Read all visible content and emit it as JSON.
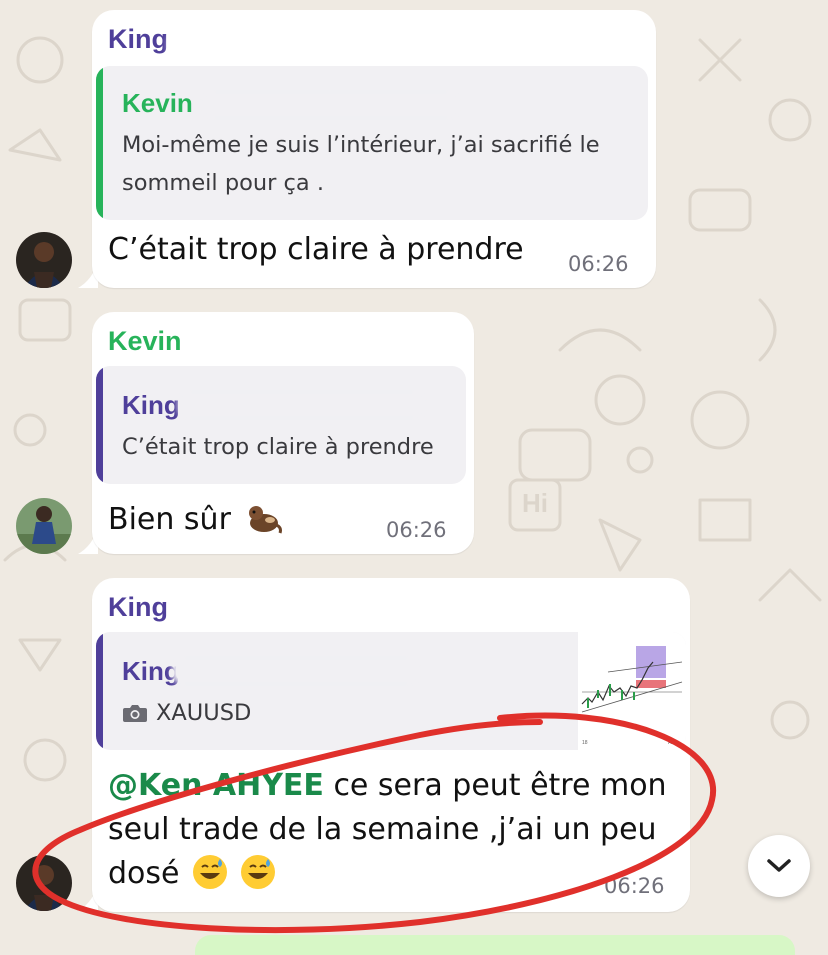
{
  "messages": [
    {
      "sender": "King",
      "quote": {
        "name": "Kevin",
        "text_line1": "Moi-même je suis l’intérieur, j’ai sacrifié le",
        "text_line2": "sommeil pour ça ."
      },
      "text": "C’était trop claire à prendre",
      "time": "06:26"
    },
    {
      "sender": "Kevin",
      "quote": {
        "name": "King",
        "text": "C’était trop claire à prendre"
      },
      "text": "Bien sûr",
      "time": "06:26"
    },
    {
      "sender": "King",
      "quote": {
        "name": "King",
        "attachment_label": "XAUUSD"
      },
      "mention": "@Ken AHYEE",
      "text_line1": " ce sera peut être mon",
      "text_line2": "seul trade de la semaine ,j’ai un peu",
      "text_line3": "dosé",
      "time": "06:26"
    }
  ],
  "colors": {
    "king_name": "#4f3f9a",
    "kevin_name": "#27b35a",
    "mention": "#1a8a4a",
    "annotation_red": "#e0302b",
    "background": "#efeae2"
  },
  "icons": {
    "scroll_down": "chevron-down-icon",
    "camera": "camera-icon"
  }
}
